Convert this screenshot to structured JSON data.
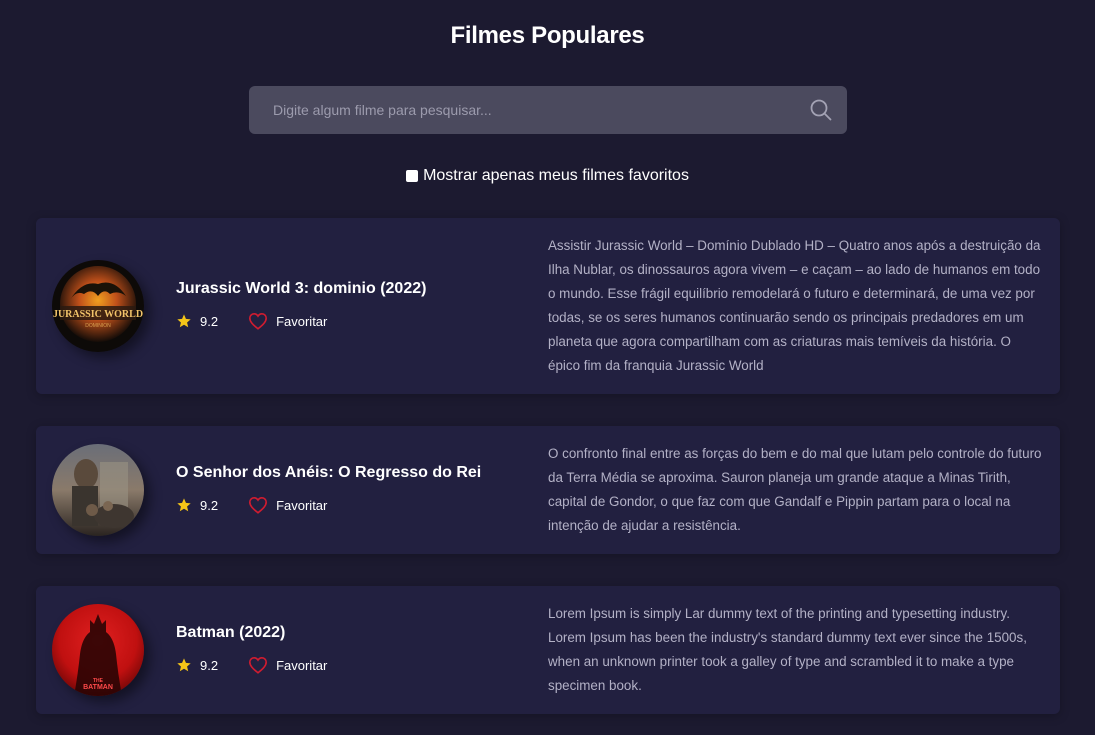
{
  "header": {
    "title": "Filmes Populares"
  },
  "search": {
    "placeholder": "Digite algum filme para pesquisar...",
    "value": "",
    "icon": "search-icon"
  },
  "favorites_filter": {
    "label": "Mostrar apenas meus filmes favoritos",
    "checked": false
  },
  "movies": [
    {
      "title": "Jurassic World 3: dominio (2022)",
      "rating": "9.2",
      "favorite_label": "Favoritar",
      "description": "Assistir Jurassic World – Domínio Dublado HD – Quatro anos após a destruição da Ilha Nublar, os dinossauros agora vivem – e caçam – ao lado de humanos em todo o mundo. Esse frágil equilíbrio remodelará o futuro e determinará, de uma vez por todas, se os seres humanos continuarão sendo os principais predadores em um planeta que agora compartilham com as criaturas mais temíveis da história. O épico fim da franquia Jurassic World",
      "poster_text": [
        "JURASSIC WORLD",
        "DOMINION"
      ]
    },
    {
      "title": "O Senhor dos Anéis: O Regresso do Rei",
      "rating": "9.2",
      "favorite_label": "Favoritar",
      "description": "O confronto final entre as forças do bem e do mal que lutam pelo controle do futuro da Terra Média se aproxima. Sauron planeja um grande ataque a Minas Tirith, capital de Gondor, o que faz com que Gandalf e Pippin partam para o local na intenção de ajudar a resistência."
    },
    {
      "title": "Batman (2022)",
      "rating": "9.2",
      "favorite_label": "Favoritar",
      "description": "Lorem Ipsum is simply Lar dummy text of the printing and typesetting industry. Lorem Ipsum has been the industry's standard dummy text ever since the 1500s, when an unknown printer took a galley of type and scrambled it to make a type specimen book.",
      "poster_text": [
        "THE",
        "BATMAN"
      ]
    }
  ],
  "colors": {
    "background": "#1c1a30",
    "card": "#222040",
    "search": "#4b4a5e",
    "star": "#f5c518",
    "heart": "#d01c30",
    "description": "#b3b1c6"
  }
}
